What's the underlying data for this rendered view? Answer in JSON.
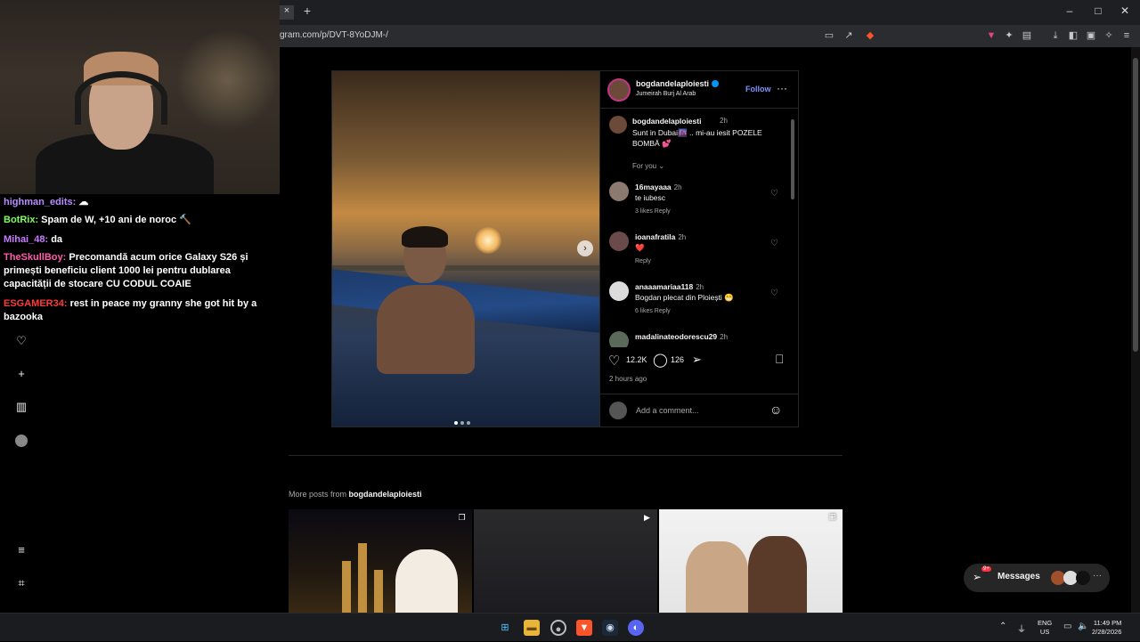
{
  "browser": {
    "url": "gram.com/p/DVT-8YoDJM-/",
    "tab_close": "×",
    "new_tab": "+",
    "window_controls": [
      "–",
      "□",
      "✕"
    ],
    "toolbar_icons": [
      "cast-icon",
      "share-icon",
      "brave-shield-icon",
      "brave-rewards-icon",
      "extensions-icon",
      "sidebar-icon",
      "downloads-icon",
      "split-view-icon",
      "wallet-icon",
      "leo-ai-icon",
      "menu-icon"
    ]
  },
  "post": {
    "username": "bogdandelaploiesti",
    "location": "Jumeirah Burj Al Arab",
    "follow_label": "Follow",
    "more_label": "···",
    "next_label": "›",
    "caption": {
      "username": "bogdandelaploiesti",
      "time": "2h",
      "text": "Sunt in Dubai🌆 .. mi-au iesit POZELE BOMBĂ 💕"
    },
    "for_you_label": "For you ⌄",
    "comments": [
      {
        "user": "16mayaaa",
        "time": "2h",
        "text": "te iubesc",
        "meta": "3 likes   Reply"
      },
      {
        "user": "ioanafratila",
        "time": "2h",
        "text": "❤️",
        "meta": "Reply"
      },
      {
        "user": "anaaamariaa118",
        "time": "2h",
        "text": "Bogdan plecat din Ploiești 😁",
        "meta": "6 likes   Reply"
      },
      {
        "user": "madalinateodorescu29",
        "time": "2h",
        "text": "",
        "meta": ""
      }
    ],
    "like_count": "12.2K",
    "comment_count": "126",
    "time_ago": "2 hours ago",
    "add_comment_placeholder": "Add a comment..."
  },
  "more_posts": {
    "prefix": "More posts from ",
    "username": "bogdandelaploiesti"
  },
  "messages": {
    "label": "Messages",
    "badge": "9+"
  },
  "chat": {
    "lines": [
      {
        "user": "highman_edits:",
        "text": " ☁",
        "color": "#b88cff"
      },
      {
        "user": "BotRix:",
        "text": " Spam de W, +10 ani de noroc 🔨",
        "color": "#7cff5a"
      },
      {
        "user": "Mihai_48:",
        "text": " da",
        "color": "#c77dff"
      },
      {
        "user": "TheSkullBoy:",
        "text": " Precomandă acum orice Galaxy S26 și primești beneficiu client 1000 lei pentru dublarea capacității de stocare CU CODUL COAIE",
        "color": "#ff5cab"
      },
      {
        "user": "ESGAMER34:",
        "text": " rest in peace my granny she got hit by a bazooka",
        "color": "#ff3b3b"
      }
    ]
  },
  "taskbar": {
    "lang": "ENG\nUS",
    "lang_top": "ENG",
    "lang_bottom": "US",
    "time": "11:49 PM",
    "date": "2/28/2026",
    "notification_badge": "9+"
  },
  "colors": {
    "accent": "#0095f6",
    "follow": "#7d93ff",
    "background": "#000000"
  }
}
